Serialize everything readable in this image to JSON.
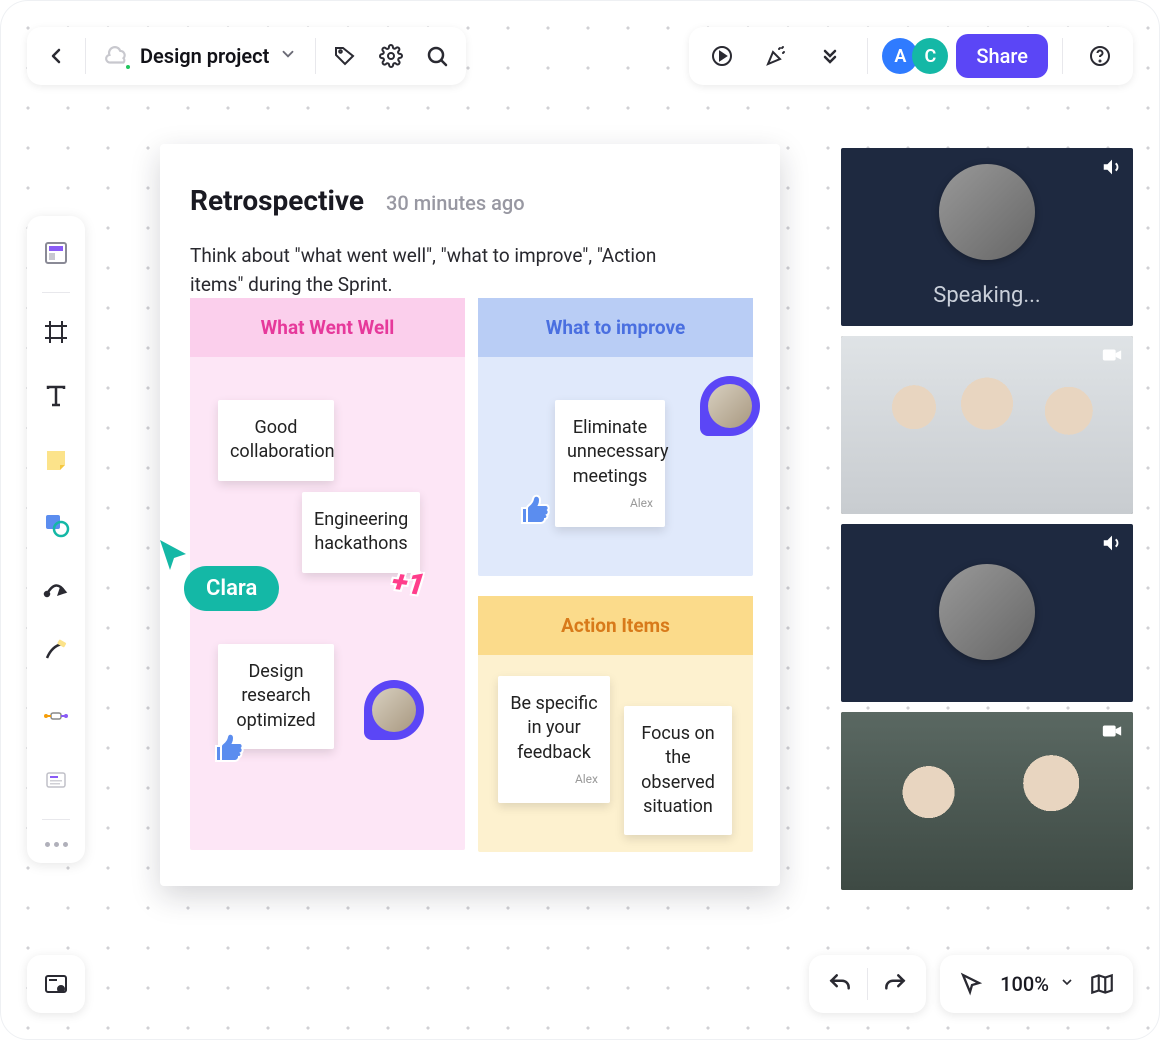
{
  "project": {
    "name": "Design project"
  },
  "topbar": {
    "share_label": "Share",
    "avatars": [
      {
        "letter": "A",
        "color": "#2f7bff"
      },
      {
        "letter": "C",
        "color": "#14b8a6"
      }
    ]
  },
  "board": {
    "title": "Retrospective",
    "time_ago": "30 minutes ago",
    "subtitle": "Think about \"what went well\", \"what to improve\", \"Action items\" during the Sprint."
  },
  "columns": {
    "well": {
      "heading": "What Went Well",
      "notes": [
        {
          "text": "Good collaboration"
        },
        {
          "text": "Engineering hackathons"
        },
        {
          "text": "Design research optimized"
        }
      ]
    },
    "improve": {
      "heading": "What to improve",
      "notes": [
        {
          "text": "Eliminate unnecessary meetings",
          "author": "Alex"
        }
      ]
    },
    "actions": {
      "heading": "Action Items",
      "notes": [
        {
          "text": "Be specific in your feedback",
          "author": "Alex"
        },
        {
          "text": "Focus on the observed situation"
        }
      ]
    }
  },
  "cursors": {
    "clara": {
      "label": "Clara",
      "color": "#14b8a6"
    }
  },
  "reactions": {
    "plus_one": "+1"
  },
  "video": {
    "tiles": [
      {
        "kind": "avatar",
        "status": "Speaking...",
        "indicator": "volume"
      },
      {
        "kind": "photo",
        "indicator": "camera"
      },
      {
        "kind": "avatar",
        "status": "",
        "indicator": "volume"
      },
      {
        "kind": "photo",
        "indicator": "camera"
      }
    ]
  },
  "zoom": {
    "level": "100%"
  },
  "tools": [
    "templates",
    "frame",
    "text",
    "sticky-note",
    "shapes",
    "line",
    "pen",
    "connector",
    "card"
  ]
}
